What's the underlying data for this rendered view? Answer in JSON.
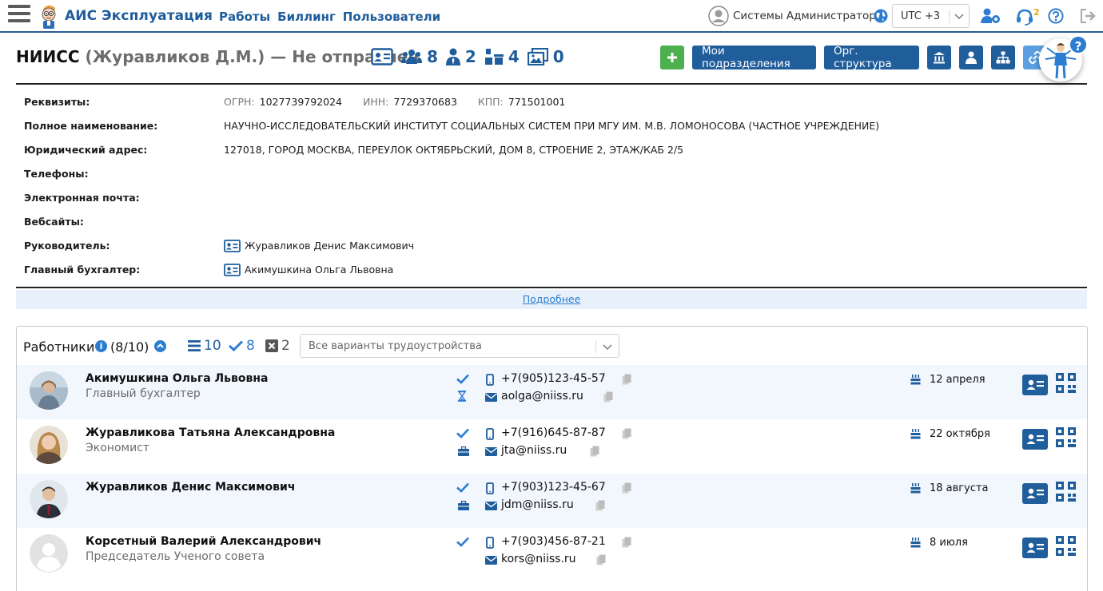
{
  "app": {
    "title": "АИС Эксплуатация"
  },
  "nav": {
    "items": [
      "Работы",
      "Биллинг",
      "Пользователи"
    ]
  },
  "user": {
    "name": "Системы Администратор",
    "timezone": "UTC +3",
    "notifications": "2"
  },
  "org": {
    "short_name": "НИИСС",
    "head": "(Журавликов Д.М.)",
    "status": "— Не отправлен",
    "counts": {
      "employees": "8",
      "heads": "2",
      "units": "4",
      "gallery": "0"
    }
  },
  "header_buttons": {
    "my_units": "Мои подразделения",
    "org_structure": "Орг. структура"
  },
  "details": {
    "rows": [
      {
        "label": "Реквизиты:"
      },
      {
        "label": "Полное наименование:",
        "value": "НАУЧНО-ИССЛЕДОВАТЕЛЬСКИЙ ИНСТИТУТ СОЦИАЛЬНЫХ СИСТЕМ ПРИ МГУ ИМ. М.В. ЛОМОНОСОВА (ЧАСТНОЕ УЧРЕЖДЕНИЕ)"
      },
      {
        "label": "Юридический адрес:",
        "value": "127018, ГОРОД МОСКВА, ПЕРЕУЛОК ОКТЯБРЬСКИЙ, ДОМ 8, СТРОЕНИЕ 2, ЭТАЖ/КАБ 2/5"
      },
      {
        "label": "Телефоны:",
        "value": ""
      },
      {
        "label": "Электронная почта:",
        "value": ""
      },
      {
        "label": "Вебсайты:",
        "value": ""
      },
      {
        "label": "Руководитель:",
        "value": "Журавликов Денис Максимович"
      },
      {
        "label": "Главный бухгалтер:",
        "value": "Акимушкина Ольга Львовна"
      }
    ],
    "requisites": {
      "ogrn_label": "ОГРН:",
      "ogrn": "1027739792024",
      "inn_label": "ИНН:",
      "inn": "7729370683",
      "kpp_label": "КПП:",
      "kpp": "771501001"
    },
    "more_link": "Подробнее"
  },
  "workers": {
    "title": "Работники",
    "count": "(8/10)",
    "total": "10",
    "active": "8",
    "removed": "2",
    "filter_placeholder": "Все варианты трудоустройства",
    "rows": [
      {
        "name": "Акимушкина Ольга Львовна",
        "position": "Главный бухгалтер",
        "phone": "+7(905)123-45-57",
        "email": "aolga@niiss.ru",
        "birthday": "12 апреля",
        "status2": "hourglass-icon"
      },
      {
        "name": "Журавликова Татьяна Александровна",
        "position": "Экономист",
        "phone": "+7(916)645-87-87",
        "email": "jta@niiss.ru",
        "birthday": "22 октября",
        "status2": "briefcase-icon"
      },
      {
        "name": "Журавликов Денис Максимович",
        "position": "",
        "phone": "+7(903)123-45-67",
        "email": "jdm@niiss.ru",
        "birthday": "18 августа",
        "status2": "briefcase-icon"
      },
      {
        "name": "Корсетный Валерий Александрович",
        "position": "Председатель Ученого совета",
        "phone": "+7(903)456-87-21",
        "email": "kors@niiss.ru",
        "birthday": "8 июля",
        "status2": ""
      }
    ]
  },
  "colors": {
    "brand": "#1f5d9b",
    "accent": "#2c7dd1",
    "green": "#4caf50",
    "row_alt": "#f2f7fd",
    "orange": "#e8a317"
  }
}
